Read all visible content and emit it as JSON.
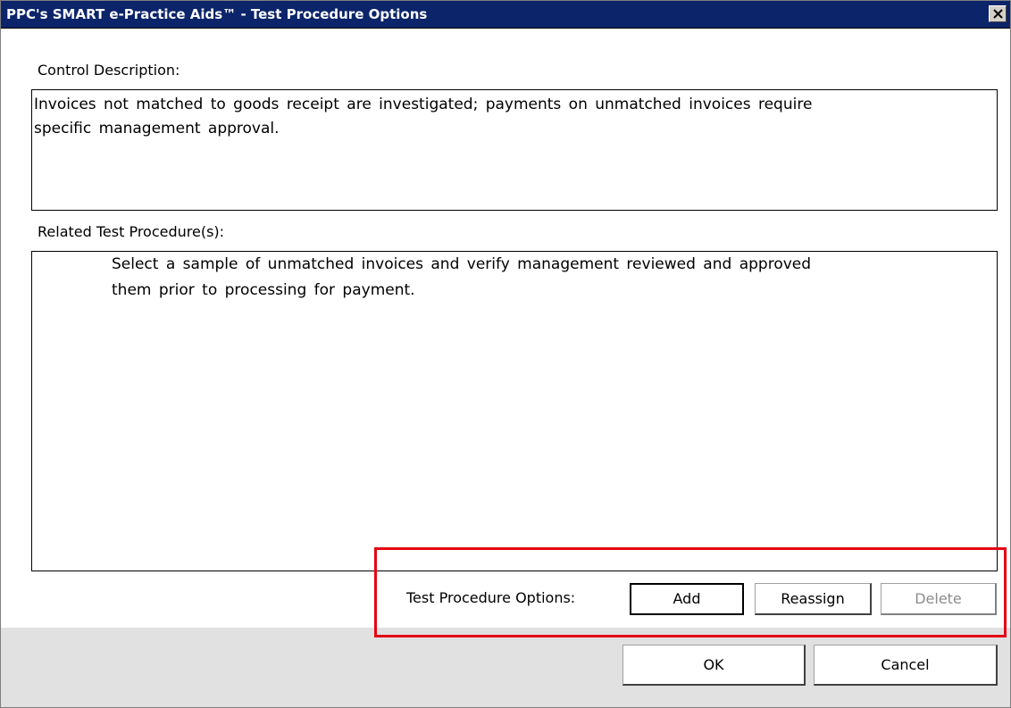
{
  "window": {
    "title": "PPC's SMART e-Practice Aids™ - Test Procedure Options",
    "close_icon": "close-icon"
  },
  "control_description": {
    "label": "Control Description:",
    "value_line1": "Invoices not matched to goods receipt are investigated; payments on unmatched invoices require",
    "value_line2": "specific management approval."
  },
  "related_procedures": {
    "label": "Related Test Procedure(s):",
    "value_line1": "Select a sample of unmatched invoices and verify management reviewed and approved",
    "value_line2": "them prior to processing for payment."
  },
  "options": {
    "label": "Test Procedure Options:",
    "add_label": "Add",
    "reassign_label": "Reassign",
    "delete_label": "Delete"
  },
  "footer": {
    "ok_label": "OK",
    "cancel_label": "Cancel"
  },
  "colors": {
    "titlebar": "#0b246a",
    "highlight": "#e30613",
    "footer": "#e1e1e1"
  }
}
